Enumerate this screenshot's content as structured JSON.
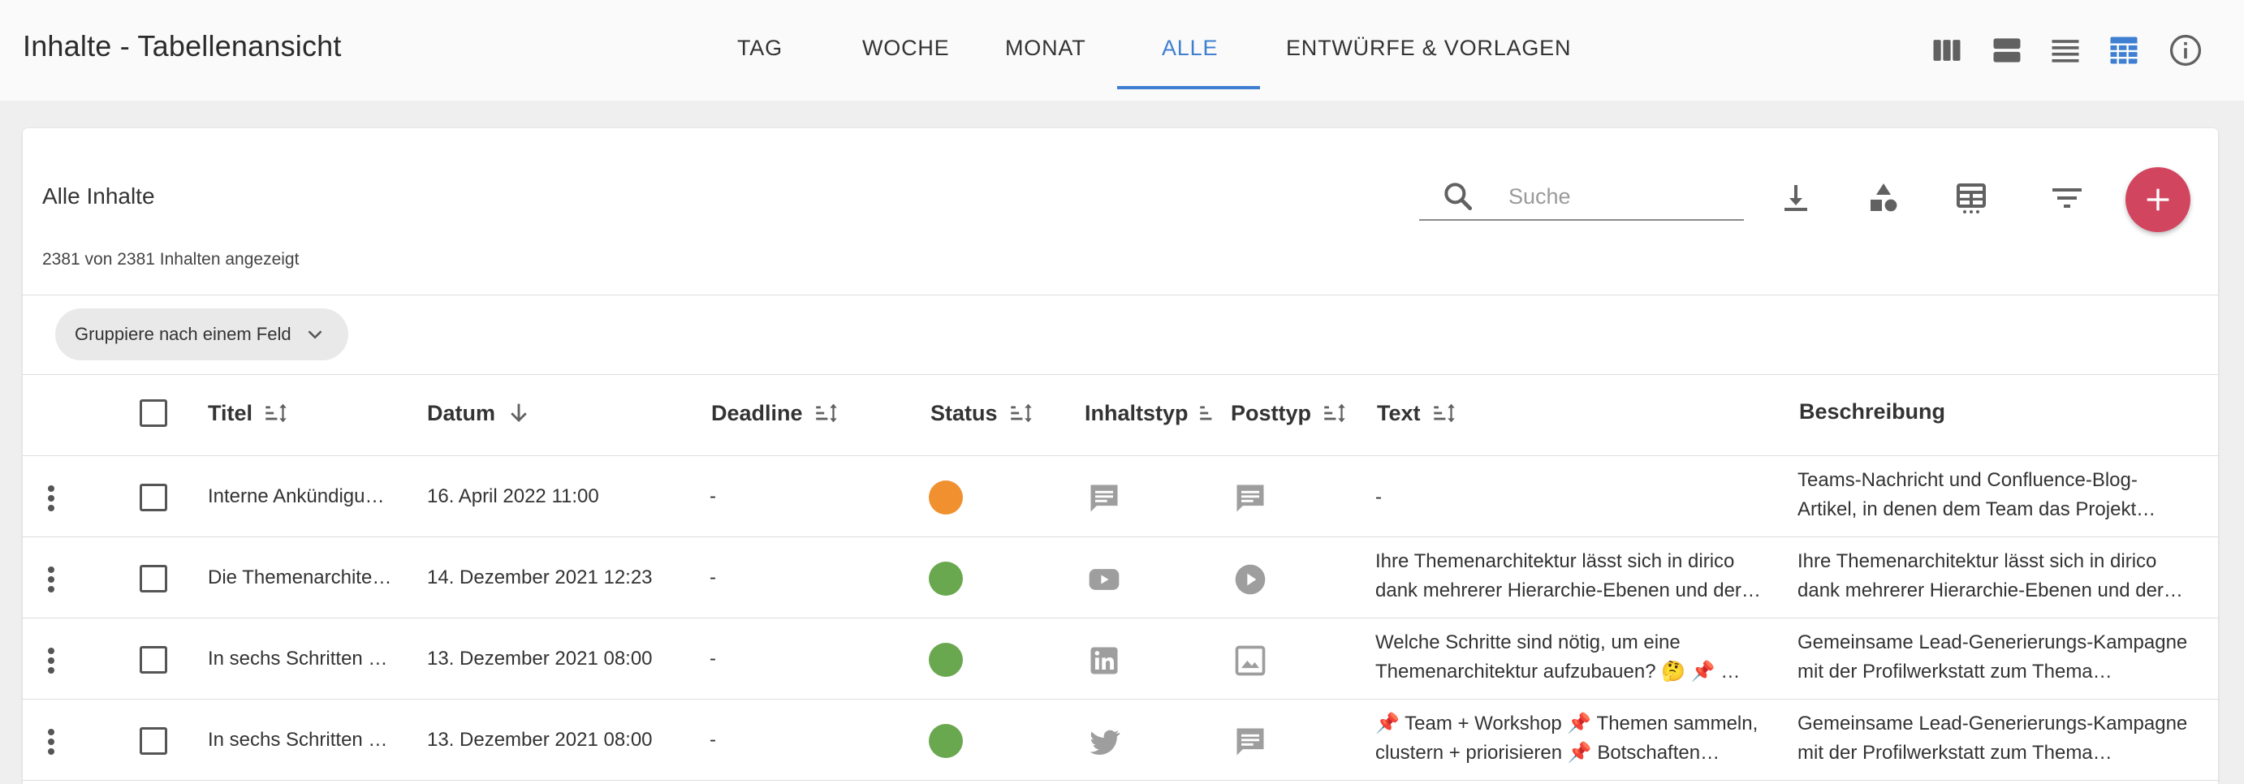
{
  "header": {
    "title": "Inhalte - Tabellenansicht",
    "tabs": [
      {
        "label": "TAG"
      },
      {
        "label": "WOCHE"
      },
      {
        "label": "MONAT"
      },
      {
        "label": "ALLE"
      },
      {
        "label": "ENTWÜRFE & VORLAGEN"
      }
    ],
    "active_tab": "ALLE",
    "view_icons": [
      "view-columns-icon",
      "view-stream-icon",
      "view-list-icon",
      "view-table-icon",
      "info-icon"
    ],
    "accent_color": "#3f7fd1"
  },
  "card": {
    "title": "Alle Inhalte",
    "count_text": "2381 von 2381 Inhalten angezeigt",
    "search": {
      "placeholder": "Suche",
      "value": ""
    },
    "tools": [
      "download-icon",
      "category-icon",
      "table-columns-icon",
      "filter-icon"
    ],
    "fab_icon": "add-icon",
    "fab_color": "#d2455f",
    "group_chip": "Gruppiere nach einem Feld"
  },
  "table": {
    "columns": [
      "Titel",
      "Datum",
      "Deadline",
      "Status",
      "Inhaltstyp",
      "Posttyp",
      "Text",
      "Beschreibung"
    ],
    "rows": [
      {
        "titel": "Interne Ankündigu…",
        "datum": "16. April 2022 11:00",
        "deadline": "-",
        "status_color": "#f0902f",
        "inhaltstyp_icon": "message-icon",
        "posttyp_icon": "message-icon",
        "text": [
          "-",
          ""
        ],
        "beschreibung": [
          "Teams-Nachricht und Confluence-Blog-",
          "Artikel, in denen dem Team das Projekt…"
        ]
      },
      {
        "titel": "Die Themenarchite…",
        "datum": "14. Dezember 2021 12:23",
        "deadline": "-",
        "status_color": "#6aa84f",
        "inhaltstyp_icon": "youtube-icon",
        "posttyp_icon": "play-circle-icon",
        "text": [
          "Ihre Themenarchitektur lässt sich in dirico",
          "dank mehrerer Hierarchie-Ebenen und der…"
        ],
        "beschreibung": [
          "Ihre Themenarchitektur lässt sich in dirico",
          "dank mehrerer Hierarchie-Ebenen und der…"
        ]
      },
      {
        "titel": "In sechs Schritten …",
        "datum": "13. Dezember 2021 08:00",
        "deadline": "-",
        "status_color": "#6aa84f",
        "inhaltstyp_icon": "linkedin-icon",
        "posttyp_icon": "image-icon",
        "text": [
          "Welche Schritte sind nötig, um eine",
          "Themenarchitektur aufzubauen? 🤔 📌 …"
        ],
        "beschreibung": [
          "Gemeinsame Lead-Generierungs-Kampagne",
          "mit der Profilwerkstatt zum Thema…"
        ]
      },
      {
        "titel": "In sechs Schritten …",
        "datum": "13. Dezember 2021 08:00",
        "deadline": "-",
        "status_color": "#6aa84f",
        "inhaltstyp_icon": "twitter-icon",
        "posttyp_icon": "message-icon",
        "text": [
          "📌 Team + Workshop 📌 Themen sammeln,",
          "clustern + priorisieren 📌 Botschaften…"
        ],
        "beschreibung": [
          "Gemeinsame Lead-Generierungs-Kampagne",
          "mit der Profilwerkstatt zum Thema…"
        ]
      }
    ]
  }
}
